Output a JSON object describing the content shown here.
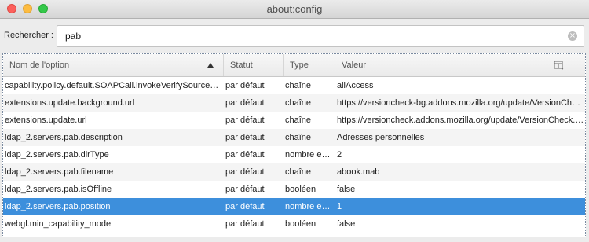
{
  "window": {
    "title": "about:config"
  },
  "search": {
    "label": "Rechercher :",
    "value": "pab"
  },
  "columns": {
    "name": "Nom de l'option",
    "status": "Statut",
    "type": "Type",
    "value": "Valeur"
  },
  "rows": [
    {
      "name": "capability.policy.default.SOAPCall.invokeVerifySourceHeader",
      "status": "par défaut",
      "type": "chaîne",
      "value": "allAccess"
    },
    {
      "name": "extensions.update.background.url",
      "status": "par défaut",
      "type": "chaîne",
      "value": "https://versioncheck-bg.addons.mozilla.org/update/VersionCheck.php"
    },
    {
      "name": "extensions.update.url",
      "status": "par défaut",
      "type": "chaîne",
      "value": "https://versioncheck.addons.mozilla.org/update/VersionCheck.php"
    },
    {
      "name": "ldap_2.servers.pab.description",
      "status": "par défaut",
      "type": "chaîne",
      "value": "Adresses personnelles"
    },
    {
      "name": "ldap_2.servers.pab.dirType",
      "status": "par défaut",
      "type": "nombre entier",
      "value": "2"
    },
    {
      "name": "ldap_2.servers.pab.filename",
      "status": "par défaut",
      "type": "chaîne",
      "value": "abook.mab"
    },
    {
      "name": "ldap_2.servers.pab.isOffline",
      "status": "par défaut",
      "type": "booléen",
      "value": "false"
    },
    {
      "name": "ldap_2.servers.pab.position",
      "status": "par défaut",
      "type": "nombre entier",
      "value": "1",
      "selected": true
    },
    {
      "name": "webgl.min_capability_mode",
      "status": "par défaut",
      "type": "booléen",
      "value": "false"
    }
  ],
  "colors": {
    "selection": "#3d8fdc",
    "close": "#fc605c",
    "minimize": "#fdbc40",
    "maximize": "#34c84a"
  }
}
